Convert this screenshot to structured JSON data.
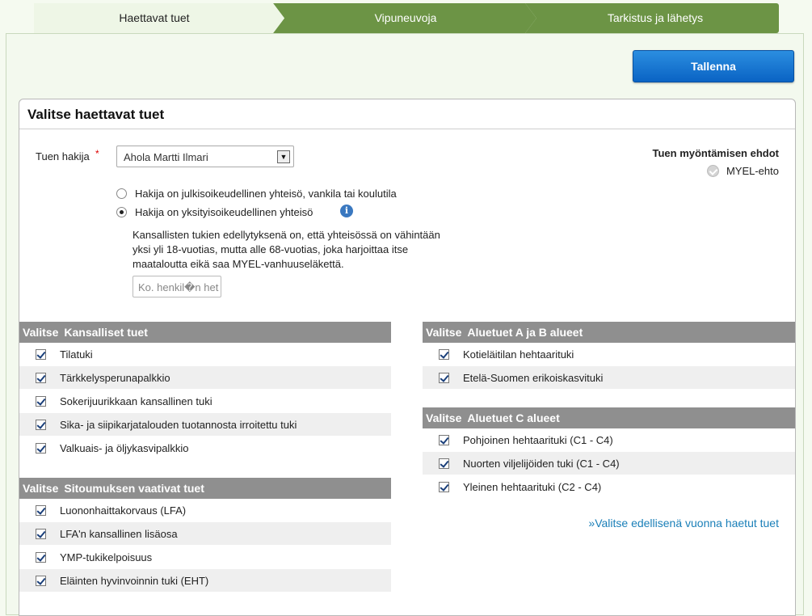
{
  "steps": [
    "Haettavat tuet",
    "Vipuneuvoja",
    "Tarkistus ja lähetys"
  ],
  "save_label": "Tallenna",
  "panel_title": "Valitse haettavat tuet",
  "applicant": {
    "label": "Tuen hakija",
    "required_mark": "*",
    "selected": "Ahola Martti Ilmari"
  },
  "radios": [
    {
      "label": "Hakija on julkisoikeudellinen yhteisö, vankila tai koulutila",
      "checked": false
    },
    {
      "label": "Hakija on yksityisoikeudellinen yhteisö",
      "checked": true
    }
  ],
  "help_text": "Kansallisten tukien edellytyksenä on, että yhteisössä on vähintään yksi yli 18-vuotias, mutta alle 68-vuotias, joka harjoittaa itse maataloutta eikä saa MYEL-vanhuuseläkettä.",
  "hetu_placeholder": "Ko. henkil�n het",
  "conditions": {
    "title": "Tuen myöntämisen ehdot",
    "item": "MYEL-ehto"
  },
  "sections": {
    "valitse": "Valitse",
    "kansalliset": {
      "title": "Kansalliset tuet",
      "items": [
        "Tilatuki",
        "Tärkkelysperunapalkkio",
        "Sokerijuurikkaan kansallinen tuki",
        "Sika- ja siipikarjatalouden tuotannosta irroitettu tuki",
        "Valkuais- ja öljykasvipalkkio"
      ]
    },
    "sitoumus": {
      "title": "Sitoumuksen vaativat tuet",
      "items": [
        "Luononhaittakorvaus (LFA)",
        "LFA'n kansallinen lisäosa",
        "YMP-tukikelpoisuus",
        "Eläinten hyvinvoinnin tuki (EHT)"
      ]
    },
    "aluetuet_ab": {
      "title": "Aluetuet A ja B alueet",
      "items": [
        "Kotieläitilan hehtaarituki",
        "Etelä-Suomen erikoiskasvituki"
      ]
    },
    "aluetuet_c": {
      "title": "Aluetuet C alueet",
      "items": [
        "Pohjoinen hehtaarituki (C1 - C4)",
        "Nuorten viljelijöiden tuki (C1 - C4)",
        "Yleinen hehtaarituki (C2 - C4)"
      ]
    }
  },
  "prev_link": "»Valitse edellisenä vuonna haetut tuet"
}
